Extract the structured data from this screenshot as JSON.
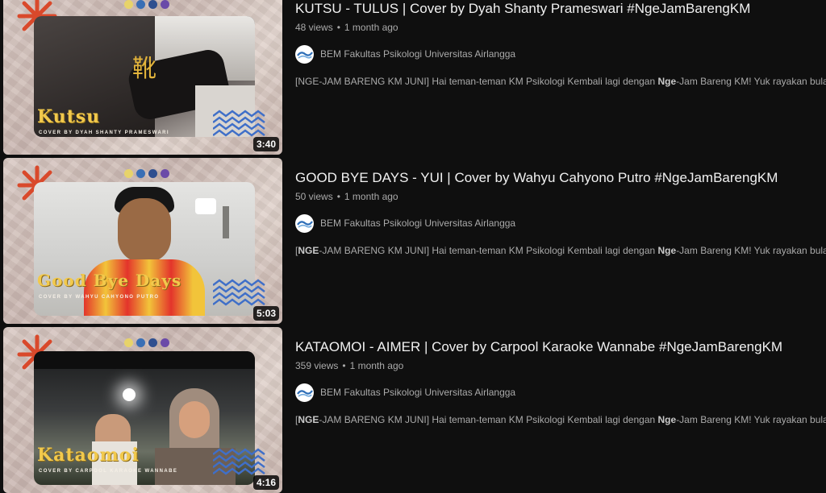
{
  "videos": [
    {
      "title": "KUTSU - TULUS | Cover by Dyah Shanty Prameswari #NgeJamBarengKM",
      "views": "48 views",
      "age": "1 month ago",
      "channel": "BEM Fakultas Psikologi Universitas Airlangga",
      "description_prefix": "[NGE-JAM BARENG KM JUNI] Hai teman-teman KM Psikologi Kembali lagi dengan ",
      "description_highlight": "Nge",
      "description_suffix": "-Jam Bareng KM! Yuk rayakan bulan ...",
      "duration": "3:40",
      "thumb_title": "Kutsu",
      "thumb_subtitle": "COVER BY DYAH SHANTY PRAMESWARI",
      "thumb_kanji": "靴"
    },
    {
      "title": "GOOD BYE DAYS - YUI | Cover by Wahyu Cahyono Putro #NgeJamBarengKM",
      "views": "50 views",
      "age": "1 month ago",
      "channel": "BEM Fakultas Psikologi Universitas Airlangga",
      "description_prefix_bold": "NGE",
      "description_prefix": "[",
      "description_rest": "-JAM BARENG KM JUNI] Hai teman-teman KM Psikologi Kembali lagi dengan ",
      "description_highlight": "Nge",
      "description_suffix": "-Jam Bareng KM! Yuk rayakan bulan ...",
      "duration": "5:03",
      "thumb_title": "Good Bye Days",
      "thumb_subtitle": "COVER BY WAHYU CAHYONO PUTRO"
    },
    {
      "title": "KATAOMOI - AIMER | Cover by Carpool Karaoke Wannabe #NgeJamBarengKM",
      "views": "359 views",
      "age": "1 month ago",
      "channel": "BEM Fakultas Psikologi Universitas Airlangga",
      "description_prefix_bold": "NGE",
      "description_prefix": "[",
      "description_rest": "-JAM BARENG KM JUNI] Hai teman-teman KM Psikologi Kembali lagi dengan ",
      "description_highlight": "Nge",
      "description_suffix": "-Jam Bareng KM! Yuk rayakan bulan ...",
      "duration": "4:16",
      "thumb_title": "Kataomoi",
      "thumb_subtitle": "COVER BY CARPOOL KARAOKE WANNABE"
    }
  ],
  "separator": "•",
  "colors": {
    "background": "#0f0f0f",
    "title_text": "#f1f1f1",
    "secondary_text": "#aaaaaa",
    "accent_asterisk": "#d9492b",
    "thumb_title_yellow": "#f2c94c",
    "zigzag_blue": "#3f6fc8"
  },
  "icons": {
    "channel_avatar": "bem-psikologi-logo",
    "thumb_decoration": "asterisk-shape",
    "thumb_zigzag": "zigzag-lines"
  }
}
